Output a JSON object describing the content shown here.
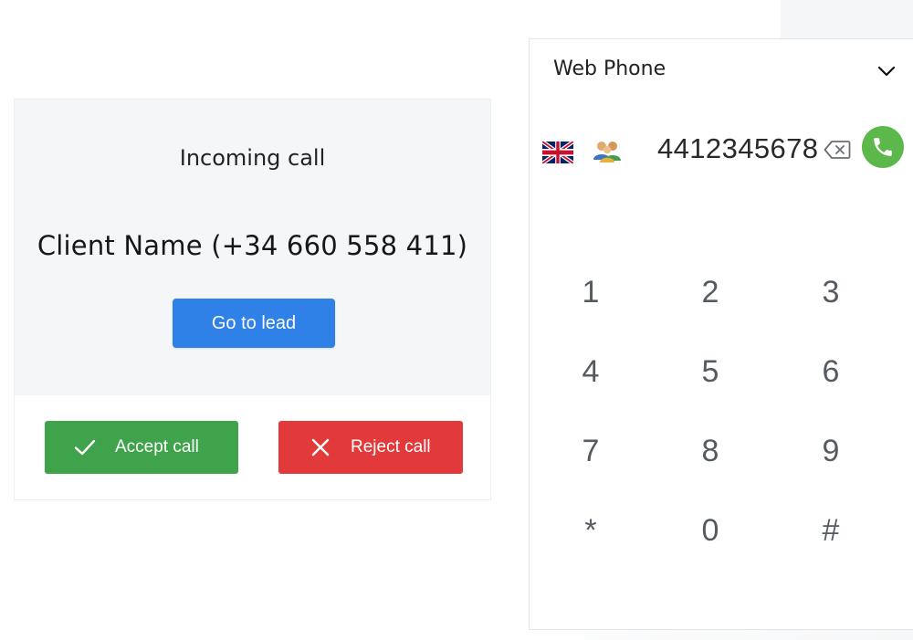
{
  "incoming_call": {
    "title": "Incoming call",
    "client_label": "Client Name (+34 660 558 411)",
    "go_to_lead_label": "Go to lead",
    "accept_label": "Accept call",
    "reject_label": "Reject call"
  },
  "web_phone": {
    "title": "Web Phone",
    "number": "4412345678",
    "keypad": [
      "1",
      "2",
      "3",
      "4",
      "5",
      "6",
      "7",
      "8",
      "9",
      "*",
      "0",
      "#"
    ]
  },
  "icons": {
    "chevron": "chevron-down-icon",
    "flag": "uk-flag-icon",
    "contacts": "contacts-icon",
    "backspace": "backspace-icon",
    "call": "phone-call-icon",
    "accept": "check-icon",
    "reject": "close-icon"
  },
  "colors": {
    "primary": "#2f80e7",
    "accept": "#3ea34b",
    "reject": "#e23a3a",
    "call": "#5cb84a",
    "card_bg": "#f4f6f8"
  }
}
